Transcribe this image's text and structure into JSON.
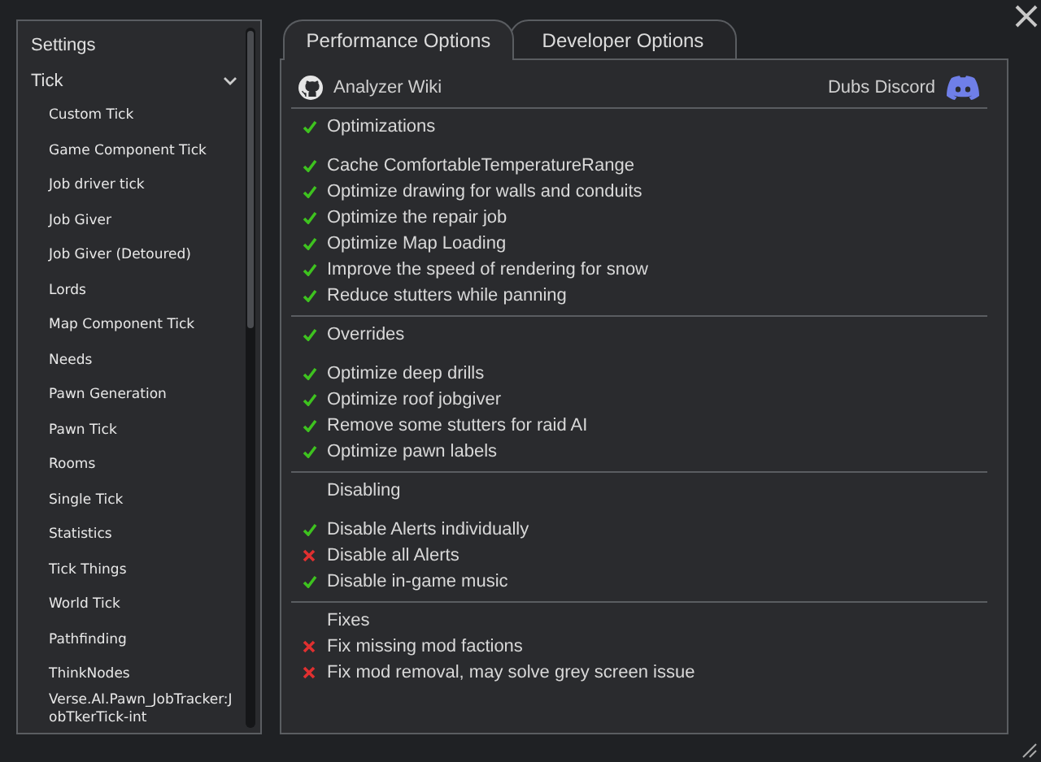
{
  "sidebar": {
    "items": [
      {
        "label": "Settings",
        "kind": "plain"
      },
      {
        "label": "Tick",
        "kind": "group",
        "expanded": true,
        "children": [
          {
            "label": "Custom Tick"
          },
          {
            "label": "Game Component Tick"
          },
          {
            "label": "Job driver tick"
          },
          {
            "label": "Job Giver"
          },
          {
            "label": "Job Giver (Detoured)"
          },
          {
            "label": "Lords"
          },
          {
            "label": "Map Component Tick"
          },
          {
            "label": "Needs"
          },
          {
            "label": "Pawn Generation"
          },
          {
            "label": "Pawn Tick"
          },
          {
            "label": "Rooms"
          },
          {
            "label": "Single Tick"
          },
          {
            "label": "Statistics"
          },
          {
            "label": "Tick Things"
          },
          {
            "label": "World Tick"
          },
          {
            "label": "Pathfinding"
          },
          {
            "label": "ThinkNodes"
          },
          {
            "label": "Verse.AI.Pawn_JobTracker:JobTkerTick-int"
          }
        ]
      }
    ]
  },
  "tabs": [
    {
      "label": "Performance Options",
      "selected": true
    },
    {
      "label": "Developer Options",
      "selected": false
    }
  ],
  "links": {
    "left": "Analyzer Wiki",
    "right": "Dubs Discord"
  },
  "sections": [
    {
      "header": {
        "label": "Optimizations",
        "kind": "toggle",
        "checked": true
      },
      "items": [
        {
          "label": "Cache ComfortableTemperatureRange",
          "checked": true
        },
        {
          "label": "Optimize drawing for walls and conduits",
          "checked": true
        },
        {
          "label": "Optimize the repair job",
          "checked": true
        },
        {
          "label": "Optimize Map Loading",
          "checked": true
        },
        {
          "label": "Improve the speed of rendering for snow",
          "checked": true
        },
        {
          "label": "Reduce stutters while panning",
          "checked": true
        }
      ]
    },
    {
      "header": {
        "label": "Overrides",
        "kind": "toggle",
        "checked": true
      },
      "items": [
        {
          "label": "Optimize deep drills",
          "checked": true
        },
        {
          "label": "Optimize roof jobgiver",
          "checked": true
        },
        {
          "label": "Remove some stutters for raid AI",
          "checked": true
        },
        {
          "label": "Optimize pawn labels",
          "checked": true
        }
      ]
    },
    {
      "header": {
        "label": "Disabling",
        "kind": "label"
      },
      "items": [
        {
          "label": "Disable Alerts individually",
          "checked": true
        },
        {
          "label": "Disable all Alerts",
          "checked": false
        },
        {
          "label": "Disable in-game music",
          "checked": true
        }
      ]
    },
    {
      "header": {
        "label": "Fixes",
        "kind": "label"
      },
      "items": [
        {
          "label": "Fix missing mod factions",
          "checked": false
        },
        {
          "label": "Fix mod removal, may solve grey screen issue",
          "checked": false
        }
      ]
    }
  ]
}
